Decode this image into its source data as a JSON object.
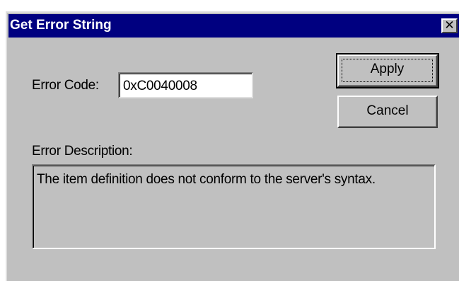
{
  "dialog": {
    "title": "Get Error String",
    "close_glyph": "✕",
    "close_icon": "close-icon"
  },
  "form": {
    "error_code_label": "Error Code:",
    "error_code_value": "0xC0040008",
    "error_description_label": "Error Description:",
    "error_description_value": "The item definition does not conform to the server's syntax."
  },
  "buttons": {
    "apply_label": "Apply",
    "cancel_label": "Cancel"
  },
  "colors": {
    "titlebar": "#000080",
    "face": "#c0c0c0"
  }
}
